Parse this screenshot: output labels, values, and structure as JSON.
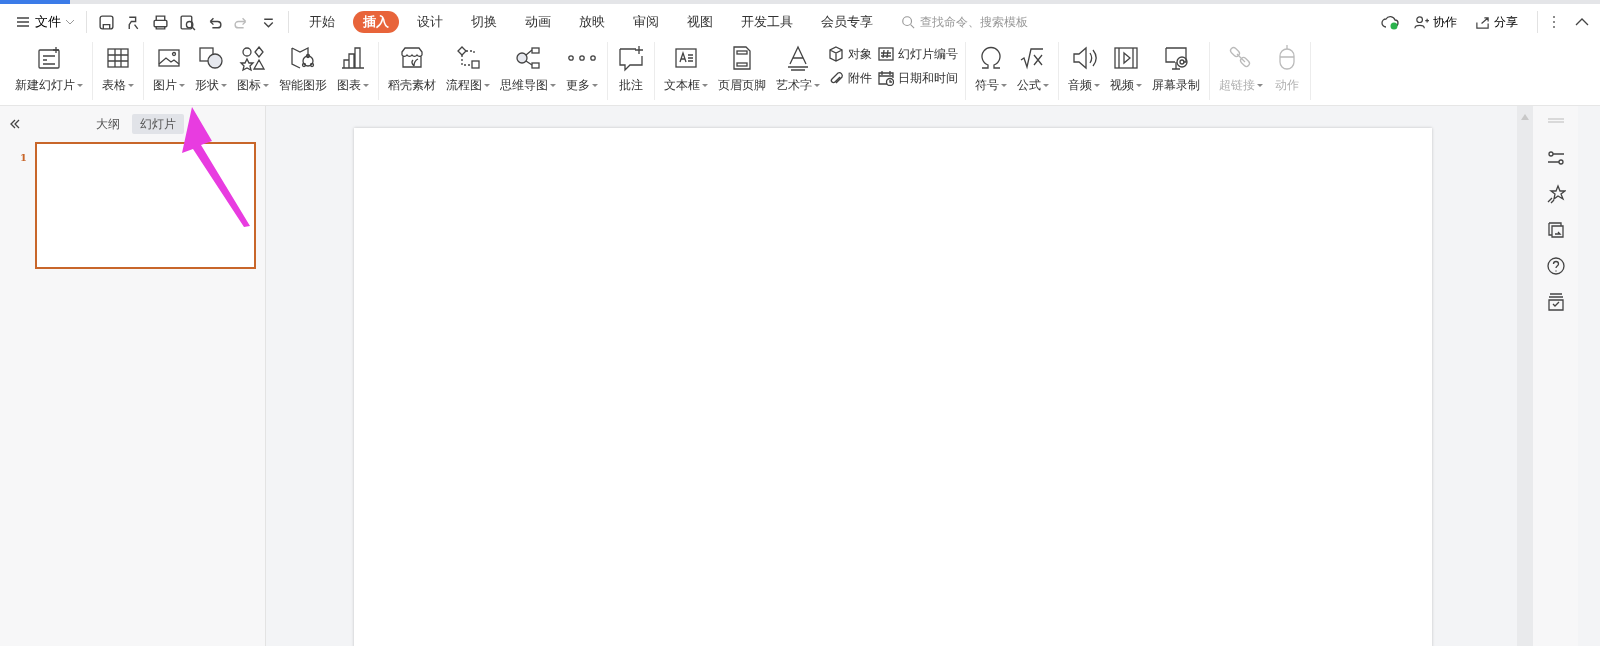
{
  "load_bar": {
    "level": 0.044
  },
  "menu": {
    "file_label": "文件",
    "tabs": [
      {
        "label": "开始",
        "selected": false
      },
      {
        "label": "插入",
        "selected": true
      },
      {
        "label": "设计",
        "selected": false
      },
      {
        "label": "切换",
        "selected": false
      },
      {
        "label": "动画",
        "selected": false
      },
      {
        "label": "放映",
        "selected": false
      },
      {
        "label": "审阅",
        "selected": false
      },
      {
        "label": "视图",
        "selected": false
      },
      {
        "label": "开发工具",
        "selected": false
      },
      {
        "label": "会员专享",
        "selected": false
      }
    ],
    "search": {
      "placeholder": "查找命令、搜索模板"
    },
    "actions": [
      {
        "label": "协作"
      },
      {
        "label": "分享"
      }
    ]
  },
  "ribbon": {
    "groups": [
      {
        "items": [
          {
            "kind": "large",
            "label": "新建幻灯片",
            "dropdown": true,
            "disabled": false
          }
        ]
      },
      {
        "items": [
          {
            "kind": "large",
            "label": "表格",
            "dropdown": true,
            "disabled": false
          }
        ]
      },
      {
        "items": [
          {
            "kind": "large",
            "label": "图片",
            "dropdown": true,
            "disabled": false
          },
          {
            "kind": "large",
            "label": "形状",
            "dropdown": true,
            "disabled": false
          },
          {
            "kind": "large",
            "label": "图标",
            "dropdown": true,
            "disabled": false
          },
          {
            "kind": "large",
            "label": "智能图形",
            "dropdown": false,
            "disabled": false
          },
          {
            "kind": "large",
            "label": "图表",
            "dropdown": true,
            "disabled": false
          }
        ]
      },
      {
        "items": [
          {
            "kind": "large",
            "label": "稻壳素材",
            "dropdown": false,
            "disabled": false
          },
          {
            "kind": "large",
            "label": "流程图",
            "dropdown": true,
            "disabled": false
          },
          {
            "kind": "large",
            "label": "思维导图",
            "dropdown": true,
            "disabled": false
          },
          {
            "kind": "large",
            "label": "更多",
            "dropdown": true,
            "disabled": false
          }
        ]
      },
      {
        "items": [
          {
            "kind": "large",
            "label": "批注",
            "dropdown": false,
            "disabled": false
          }
        ]
      },
      {
        "items": [
          {
            "kind": "large",
            "label": "文本框",
            "dropdown": true,
            "disabled": false
          },
          {
            "kind": "large",
            "label": "页眉页脚",
            "dropdown": false,
            "disabled": false
          },
          {
            "kind": "large",
            "label": "艺术字",
            "dropdown": true,
            "disabled": false
          },
          {
            "kind": "stack",
            "items": [
              {
                "label": "对象"
              },
              {
                "label": "附件"
              }
            ]
          },
          {
            "kind": "stack",
            "items": [
              {
                "label": "幻灯片编号"
              },
              {
                "label": "日期和时间"
              }
            ]
          }
        ]
      },
      {
        "items": [
          {
            "kind": "large",
            "label": "符号",
            "dropdown": true,
            "disabled": false
          },
          {
            "kind": "large",
            "label": "公式",
            "dropdown": true,
            "disabled": false
          }
        ]
      },
      {
        "items": [
          {
            "kind": "large",
            "label": "音频",
            "dropdown": true,
            "disabled": false
          },
          {
            "kind": "large",
            "label": "视频",
            "dropdown": true,
            "disabled": false
          },
          {
            "kind": "large",
            "label": "屏幕录制",
            "dropdown": false,
            "disabled": false
          }
        ]
      },
      {
        "items": [
          {
            "kind": "large",
            "label": "超链接",
            "dropdown": true,
            "disabled": true
          },
          {
            "kind": "large",
            "label": "动作",
            "dropdown": false,
            "disabled": true
          }
        ]
      }
    ]
  },
  "slides_panel": {
    "tabs": [
      {
        "label": "大纲",
        "selected": false
      },
      {
        "label": "幻灯片",
        "selected": true
      }
    ],
    "slides": [
      {
        "number": "1",
        "selected": true
      }
    ]
  }
}
